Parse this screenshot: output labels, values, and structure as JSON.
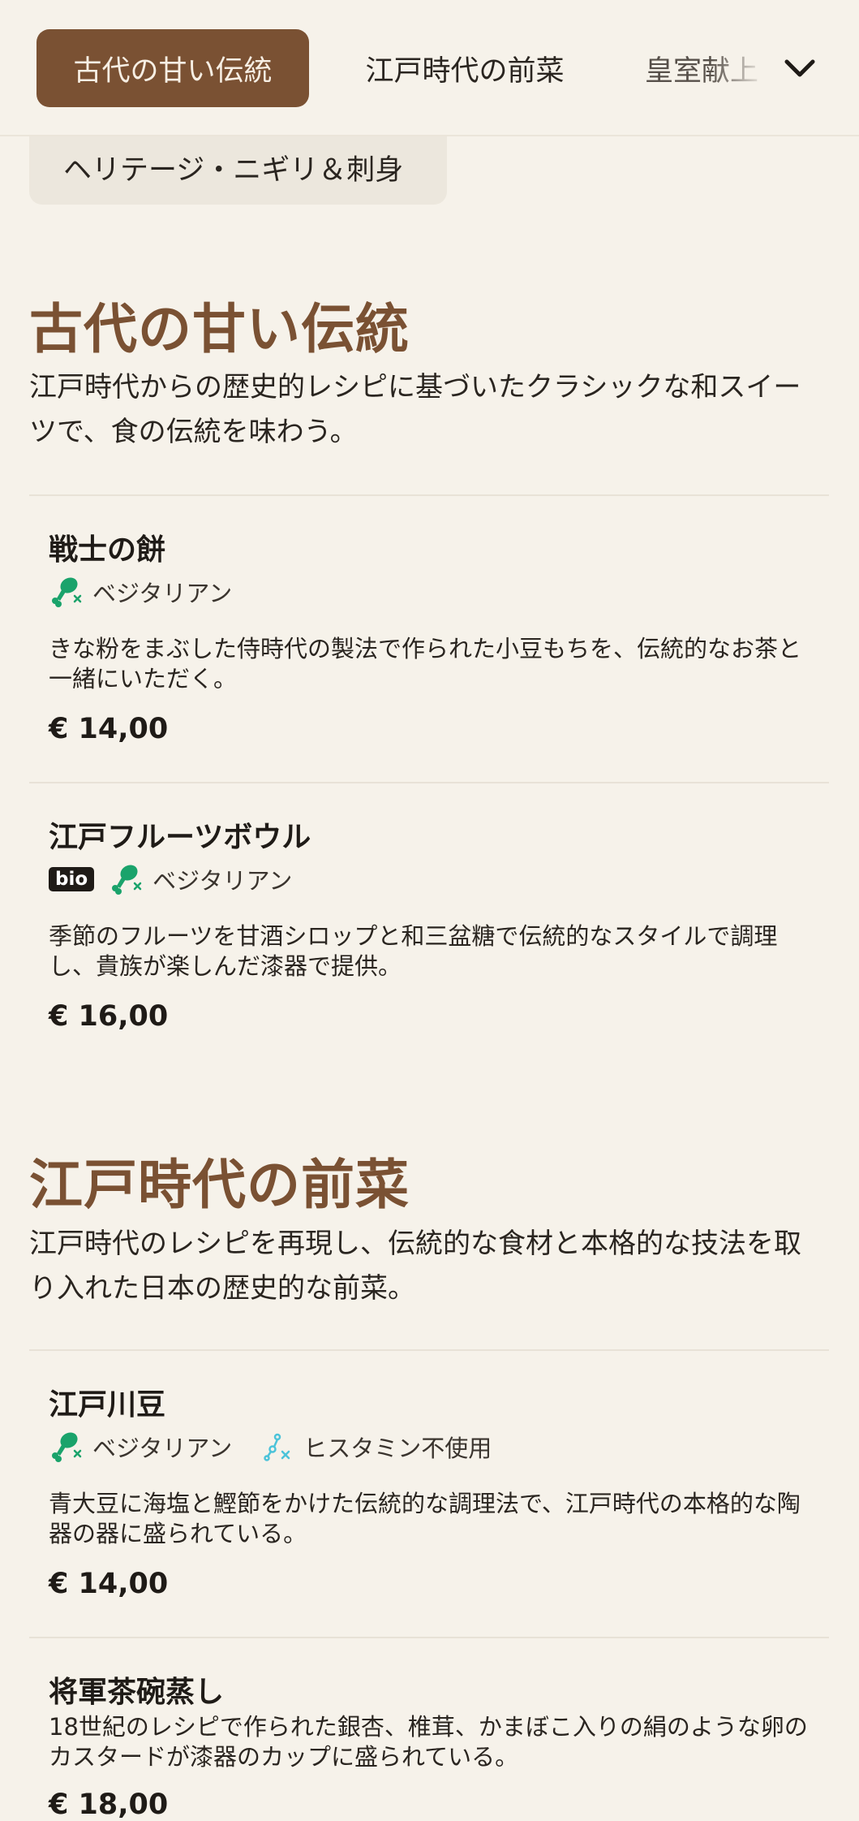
{
  "nav": {
    "tabs": [
      "古代の甘い伝統",
      "江戸時代の前菜",
      "皇室献上"
    ],
    "active_index": 0,
    "subcategory": "ヘリテージ・ニギリ＆刺身"
  },
  "sections": [
    {
      "title": "古代の甘い伝統",
      "description": "江戸時代からの歴史的レシピに基づいたクラシックな和スイーツで、食の伝統を味わう。",
      "items": [
        {
          "name": "戦士の餅",
          "tags": [
            "ベジタリアン"
          ],
          "description": "きな粉をまぶした侍時代の製法で作られた小豆もちを、伝統的なお茶と一緒にいただく。",
          "price": "€ 14,00"
        },
        {
          "name": "江戸フルーツボウル",
          "badge": "bio",
          "tags": [
            "ベジタリアン"
          ],
          "description": "季節のフルーツを甘酒シロップと和三盆糖で伝統的なスタイルで調理し、貴族が楽しんだ漆器で提供。",
          "price": "€ 16,00"
        }
      ]
    },
    {
      "title": "江戸時代の前菜",
      "description": "江戸時代のレシピを再現し、伝統的な食材と本格的な技法を取り入れた日本の歴史的な前菜。",
      "items": [
        {
          "name": "江戸川豆",
          "tags": [
            "ベジタリアン",
            "ヒスタミン不使用"
          ],
          "description": "青大豆に海塩と鰹節をかけた伝統的な調理法で、江戸時代の本格的な陶器の器に盛られている。",
          "price": "€ 14,00"
        },
        {
          "name": "将軍茶碗蒸し",
          "description": "18世紀のレシピで作られた銀杏、椎茸、かまぼこ入りの絹のような卵のカスタードが漆器のカップに盛られている。",
          "price": "€ 18,00"
        }
      ]
    }
  ],
  "colors": {
    "background": "#f6f2ea",
    "accent": "#7a5133",
    "vegetarian_icon": "#1aa36b",
    "histamine_icon": "#4cc3d9"
  },
  "icons": {
    "vegetarian": "meat-crossed-icon",
    "histamine_free": "histamine-crossed-icon",
    "expand": "chevron-down-icon"
  }
}
